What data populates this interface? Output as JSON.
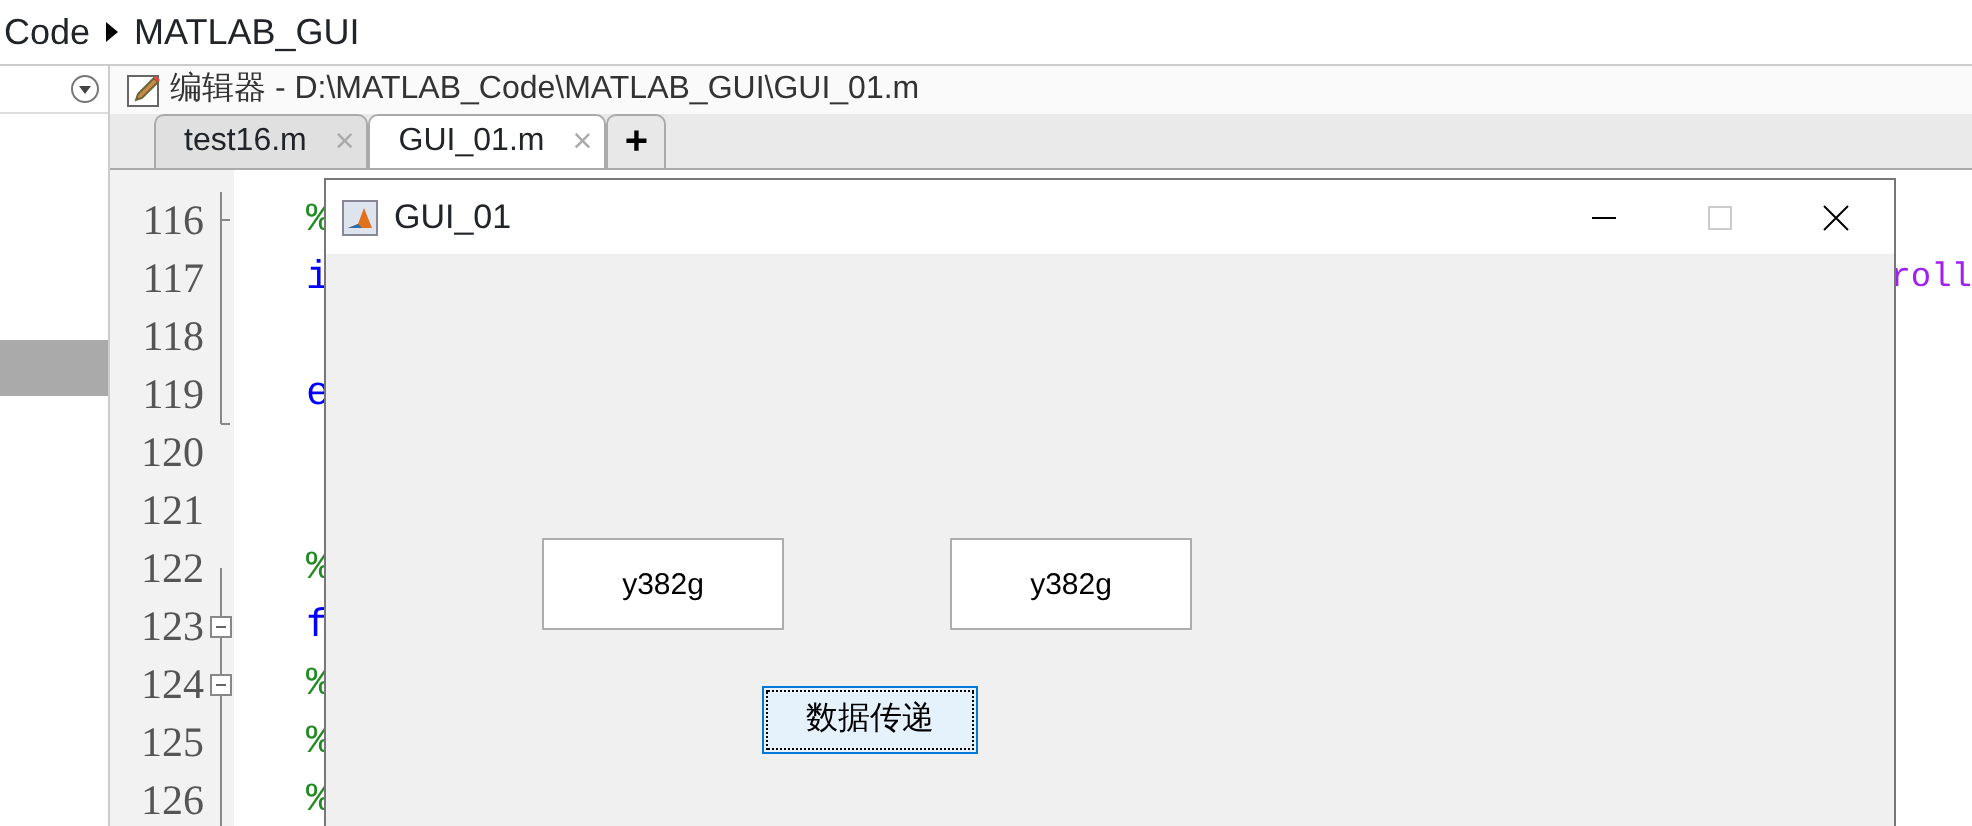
{
  "breadcrumb": [
    "Code",
    "MATLAB_GUI"
  ],
  "editor": {
    "title": "编辑器 - D:\\MATLAB_Code\\MATLAB_GUI\\GUI_01.m",
    "tabs": [
      {
        "label": "test16.m",
        "selected": false,
        "close": "×"
      },
      {
        "label": "GUI_01.m",
        "selected": true,
        "close": "×"
      }
    ],
    "new_tab": "+",
    "lines": [
      {
        "number": "116",
        "code": "%",
        "kind": "comment",
        "foldable": false
      },
      {
        "number": "117",
        "code": "i",
        "kind": "keyword",
        "foldable": false,
        "tail": "roll"
      },
      {
        "number": "118",
        "foldable": false
      },
      {
        "number": "119",
        "code": "e",
        "kind": "keyword",
        "foldable": false
      },
      {
        "number": "120",
        "foldable": false
      },
      {
        "number": "121",
        "foldable": false
      },
      {
        "number": "122",
        "code": "%",
        "kind": "comment",
        "foldable": false
      },
      {
        "number": "123",
        "code": "f",
        "kind": "keyword",
        "foldable": true
      },
      {
        "number": "124",
        "code": "%",
        "kind": "comment",
        "foldable": true
      },
      {
        "number": "125",
        "code": "%",
        "kind": "comment",
        "foldable": false
      },
      {
        "number": "126",
        "code": "%",
        "kind": "comment",
        "foldable": false
      }
    ]
  },
  "figure": {
    "title": "GUI_01",
    "fields": [
      {
        "value": "y382g"
      },
      {
        "value": "y382g"
      }
    ],
    "button": {
      "label": "数据传递",
      "focused": true
    }
  }
}
